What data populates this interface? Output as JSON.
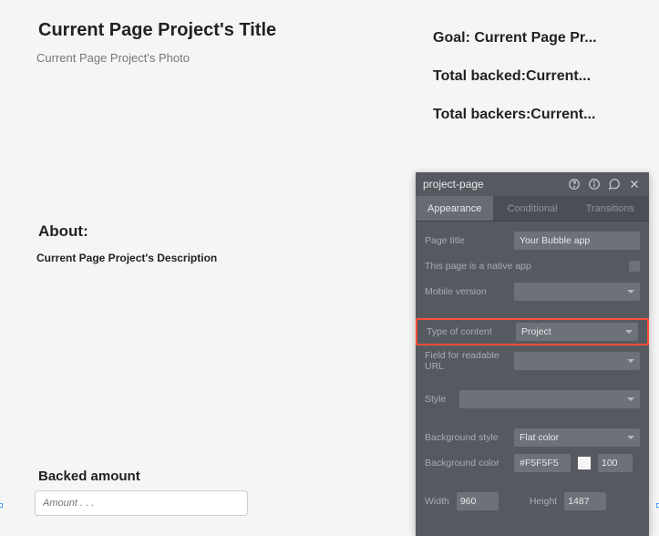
{
  "page": {
    "title": "Current Page Project's Title",
    "photo": "Current Page Project's Photo",
    "goal_label": "Goal: Current Page Pr...",
    "total_backed_label": "Total backed:Current...",
    "total_backers_label": "Total backers:Current...",
    "about_heading": "About:",
    "about_desc": "Current Page Project's Description",
    "backed_heading": "Backed amount",
    "amount_placeholder": "Amount . . ."
  },
  "panel": {
    "title": "project-page",
    "tabs": {
      "appearance": "Appearance",
      "conditional": "Conditional",
      "transitions": "Transitions"
    },
    "rows": {
      "page_title": {
        "label": "Page title",
        "value": "Your Bubble app"
      },
      "native_app": {
        "label": "This page is a native app"
      },
      "mobile_version": {
        "label": "Mobile version",
        "value": ""
      },
      "type_of_content": {
        "label": "Type of content",
        "value": "Project"
      },
      "readable_url": {
        "label": "Field for readable URL",
        "value": ""
      },
      "style": {
        "label": "Style",
        "value": ""
      },
      "background_style": {
        "label": "Background style",
        "value": "Flat color"
      },
      "background_color": {
        "label": "Background color",
        "hex": "#F5F5F5",
        "opacity": "100"
      },
      "width": {
        "label": "Width",
        "value": "960"
      },
      "height": {
        "label": "Height",
        "value": "1487"
      }
    }
  }
}
